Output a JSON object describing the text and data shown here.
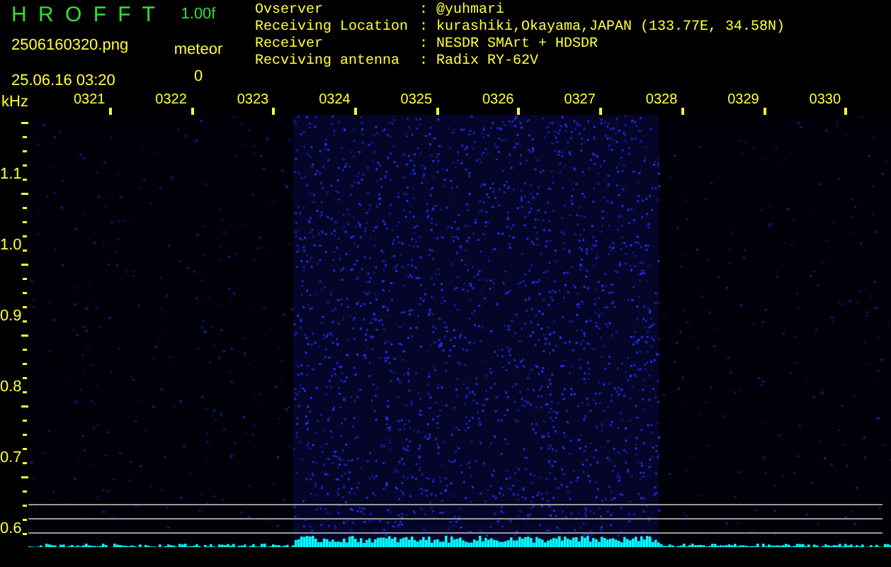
{
  "header": {
    "title": "H R O F F T",
    "version": "1.00f",
    "filename": "2506160320.png",
    "datetime": "25.06.16 03:20",
    "detection_label": "meteor",
    "detection_count": "0"
  },
  "info": [
    {
      "label": "Ovserver",
      "separator": ":",
      "value": "@yuhmari"
    },
    {
      "label": "Receiving Location",
      "separator": ":",
      "value": "kurashiki,Okayama,JAPAN (133.77E, 34.58N)"
    },
    {
      "label": "Receiver",
      "separator": ":",
      "value": "NESDR SMArt + HDSDR"
    },
    {
      "label": "Recviving antenna",
      "separator": ":",
      "value": "Radix RY-62V"
    }
  ],
  "frequency_axis": {
    "unit": "kHz",
    "labels": [
      "1.1",
      "1.0",
      "0.9",
      "0.8",
      "0.7",
      "0.6"
    ]
  },
  "time_labels": [
    "0321",
    "0322",
    "0323",
    "0324",
    "0325",
    "0326",
    "0327",
    "0328",
    "0329",
    "0330"
  ]
}
